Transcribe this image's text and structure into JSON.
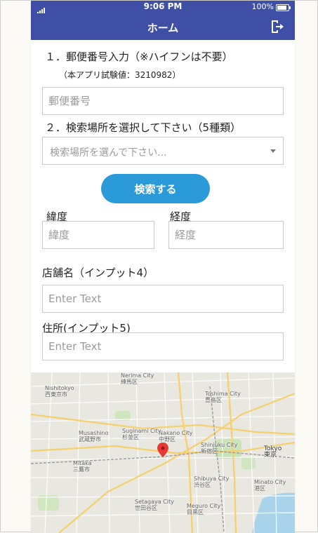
{
  "status_bar": {
    "time": "9:06 PM",
    "battery": "100%"
  },
  "header": {
    "title": "ホーム",
    "logout_icon": "logout-icon"
  },
  "form": {
    "postal": {
      "label": "１．郵便番号入力（※ハイフンは不要）",
      "note": "（本アプリ試験値：3210982）",
      "placeholder": "郵便番号"
    },
    "location": {
      "label": "２．検索場所を選択して下さい（5種類）",
      "placeholder": "検索場所を選んで下さい..."
    },
    "search_button": "検索する",
    "latitude": {
      "label": "緯度",
      "placeholder": "緯度"
    },
    "longitude": {
      "label": "経度",
      "placeholder": "経度"
    },
    "store_name": {
      "label": "店舗名（インプット4）",
      "placeholder": "Enter Text"
    },
    "address": {
      "label": "住所(インプット5)",
      "placeholder": "Enter Text"
    }
  },
  "map": {
    "places": [
      {
        "name": "Nerima City",
        "ja": "練馬区"
      },
      {
        "name": "Nishitokyo",
        "ja": "西東京市"
      },
      {
        "name": "Toshima City",
        "ja": "豊島区"
      },
      {
        "name": "Nakano City",
        "ja": "中野区"
      },
      {
        "name": "Shinjuku City",
        "ja": "新宿区"
      },
      {
        "name": "Suginami City",
        "ja": "杉並区"
      },
      {
        "name": "Shibuya City",
        "ja": "渋谷区"
      },
      {
        "name": "Tokyo",
        "ja": "東京"
      },
      {
        "name": "Minato City",
        "ja": "港区"
      },
      {
        "name": "Setagaya City",
        "ja": "世田谷区"
      },
      {
        "name": "Meguro City",
        "ja": "目黒区"
      },
      {
        "name": "Musashino",
        "ja": "武蔵野市"
      },
      {
        "name": "Mitaka",
        "ja": "三鷹市"
      }
    ],
    "marker_color": "#e53935"
  },
  "colors": {
    "primary": "#3f4fa6",
    "button": "#2a9bd8"
  }
}
